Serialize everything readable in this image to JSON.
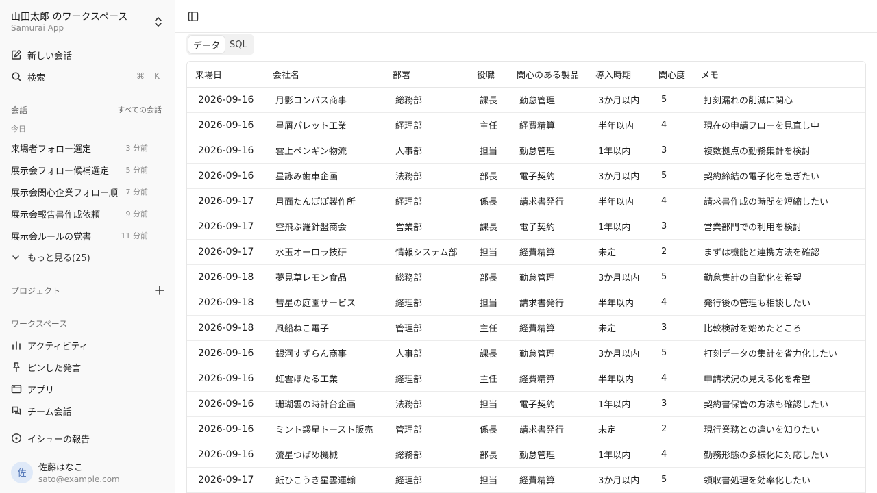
{
  "sidebar": {
    "workspace_title": "山田太郎 のワークスペース",
    "workspace_subtitle": "Samurai App",
    "new_chat": "新しい会話",
    "search": "検索",
    "search_kbd_cmd": "⌘",
    "search_kbd_key": "K",
    "conversations_label": "会話",
    "all_conversations": "すべての会話",
    "today_label": "今日",
    "conversations": [
      {
        "title": "来場者フォロー選定",
        "time": "3 分前"
      },
      {
        "title": "展示会フォロー候補選定",
        "time": "5 分前"
      },
      {
        "title": "展示会関心企業フォロー順",
        "time": "7 分前"
      },
      {
        "title": "展示会報告書作成依頼",
        "time": "9 分前"
      },
      {
        "title": "展示会ルールの覚書",
        "time": "11 分前"
      }
    ],
    "more": "もっと見る(25)",
    "projects_label": "プロジェクト",
    "workspace_label": "ワークスペース",
    "workspace_items": [
      "アクティビティ",
      "ピンした発言",
      "アプリ",
      "チーム会話"
    ],
    "report_issue": "イシューの報告",
    "user": {
      "initial": "佐",
      "name": "佐藤はなこ",
      "email": "sato@example.com"
    }
  },
  "main": {
    "tabs": [
      {
        "label": "データ"
      },
      {
        "label": "SQL"
      }
    ],
    "table": {
      "columns": [
        "来場日",
        "会社名",
        "部署",
        "役職",
        "関心のある製品",
        "導入時期",
        "関心度",
        "メモ"
      ],
      "rows": [
        [
          "2026-09-16",
          "月影コンパス商事",
          "総務部",
          "課長",
          "勤怠管理",
          "3か月以内",
          "5",
          "打刻漏れの削減に関心"
        ],
        [
          "2026-09-16",
          "星屑パレット工業",
          "経理部",
          "主任",
          "経費精算",
          "半年以内",
          "4",
          "現在の申請フローを見直し中"
        ],
        [
          "2026-09-16",
          "雲上ペンギン物流",
          "人事部",
          "担当",
          "勤怠管理",
          "1年以内",
          "3",
          "複数拠点の勤務集計を検討"
        ],
        [
          "2026-09-16",
          "星詠み歯車企画",
          "法務部",
          "部長",
          "電子契約",
          "3か月以内",
          "5",
          "契約締結の電子化を急ぎたい"
        ],
        [
          "2026-09-17",
          "月面たんぽぽ製作所",
          "経理部",
          "係長",
          "請求書発行",
          "半年以内",
          "4",
          "請求書作成の時間を短縮したい"
        ],
        [
          "2026-09-17",
          "空飛ぶ羅針盤商会",
          "営業部",
          "課長",
          "電子契約",
          "1年以内",
          "3",
          "営業部門での利用を検討"
        ],
        [
          "2026-09-17",
          "水玉オーロラ技研",
          "情報システム部",
          "担当",
          "経費精算",
          "未定",
          "2",
          "まずは機能と連携方法を確認"
        ],
        [
          "2026-09-18",
          "夢見草レモン食品",
          "総務部",
          "部長",
          "勤怠管理",
          "3か月以内",
          "5",
          "勤怠集計の自動化を希望"
        ],
        [
          "2026-09-18",
          "彗星の庭園サービス",
          "経理部",
          "担当",
          "請求書発行",
          "半年以内",
          "4",
          "発行後の管理も相談したい"
        ],
        [
          "2026-09-18",
          "風船ねこ電子",
          "管理部",
          "主任",
          "経費精算",
          "未定",
          "3",
          "比較検討を始めたところ"
        ],
        [
          "2026-09-16",
          "銀河すずらん商事",
          "人事部",
          "課長",
          "勤怠管理",
          "3か月以内",
          "5",
          "打刻データの集計を省力化したい"
        ],
        [
          "2026-09-16",
          "虹雲ほたる工業",
          "経理部",
          "主任",
          "経費精算",
          "半年以内",
          "4",
          "申請状況の見える化を希望"
        ],
        [
          "2026-09-16",
          "珊瑚雲の時計台企画",
          "法務部",
          "担当",
          "電子契約",
          "1年以内",
          "3",
          "契約書保管の方法も確認したい"
        ],
        [
          "2026-09-16",
          "ミント惑星トースト販売",
          "管理部",
          "係長",
          "請求書発行",
          "未定",
          "2",
          "現行業務との違いを知りたい"
        ],
        [
          "2026-09-16",
          "流星つばめ機械",
          "総務部",
          "部長",
          "勤怠管理",
          "1年以内",
          "4",
          "勤務形態の多様化に対応したい"
        ],
        [
          "2026-09-17",
          "紙ひこうき星雲運輸",
          "経理部",
          "担当",
          "経費精算",
          "3か月以内",
          "5",
          "領収書処理を効率化したい"
        ]
      ]
    }
  }
}
